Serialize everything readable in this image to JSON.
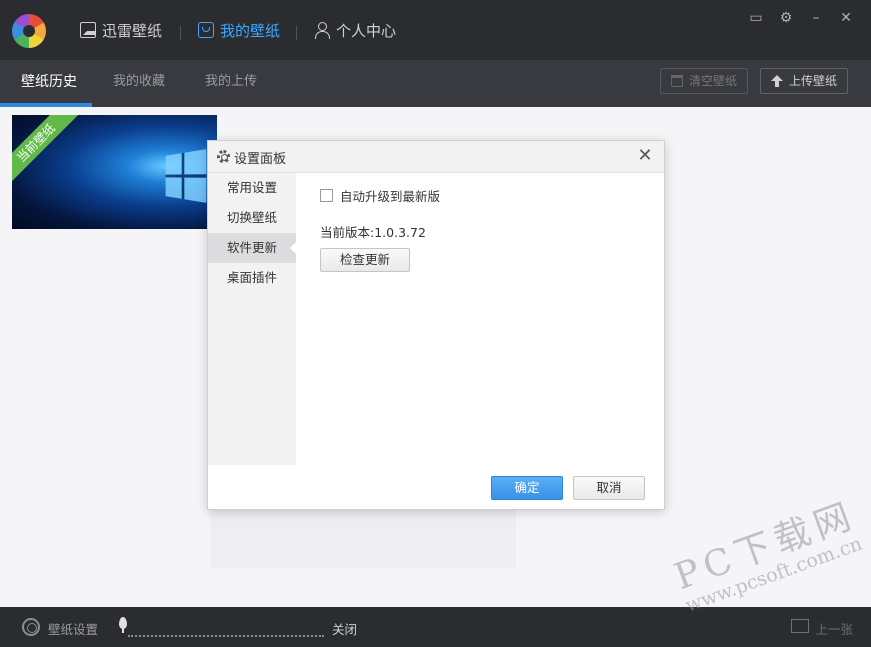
{
  "titlebar": {
    "nav": [
      {
        "label": "迅雷壁纸",
        "icon": "image-icon"
      },
      {
        "label": "我的壁纸",
        "icon": "my-wallpaper-icon",
        "active": true
      },
      {
        "label": "个人中心",
        "icon": "user-icon"
      }
    ],
    "controls": {
      "feedback": "▭",
      "settings": "⚙",
      "minimize": "–",
      "close": "✕"
    }
  },
  "subbar": {
    "tabs": [
      {
        "label": "壁纸历史",
        "active": true
      },
      {
        "label": "我的收藏"
      },
      {
        "label": "我的上传"
      }
    ],
    "clear_button": "清空壁纸",
    "upload_button": "上传壁纸"
  },
  "content": {
    "current_badge": "当前壁纸"
  },
  "dialog": {
    "title": "设置面板",
    "close": "✕",
    "sidebar": [
      {
        "label": "常用设置"
      },
      {
        "label": "切换壁纸"
      },
      {
        "label": "软件更新",
        "active": true
      },
      {
        "label": "桌面插件"
      }
    ],
    "auto_upgrade_label": "自动升级到最新版",
    "auto_upgrade_checked": false,
    "version_text": "当前版本:1.0.3.72",
    "check_update_button": "检查更新",
    "ok_button": "确定",
    "cancel_button": "取消"
  },
  "bottombar": {
    "settings_label": "壁纸设置",
    "interval_label": "关闭",
    "prev_label": "上一张"
  },
  "watermark": {
    "main": "PC下载网",
    "sub": "www.pcsoft.com.cn"
  },
  "colors": {
    "accent": "#3ea8ff",
    "titlebar_bg": "#2b2c30",
    "subbar_bg": "#393a3f",
    "ok_button": "#3a92e6",
    "badge_green": "#62b94a"
  }
}
